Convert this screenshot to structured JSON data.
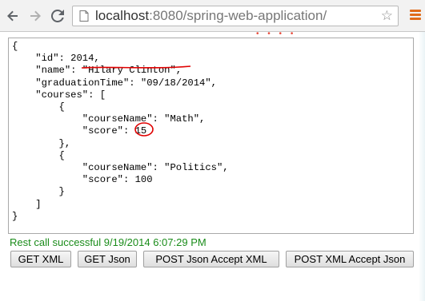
{
  "browser": {
    "url_host": "localhost",
    "url_rest": ":8080/spring-web-application/",
    "icons": {
      "back": "back-arrow-icon",
      "forward": "forward-arrow-icon",
      "reload": "reload-icon",
      "page": "page-icon",
      "bookmark": "star-icon",
      "menu": "hamburger-menu-icon"
    }
  },
  "json_response": {
    "lines": [
      "{",
      "    \"id\": 2014,",
      "    \"name\": \"Hilary Clinton\",",
      "    \"graduationTime\": \"09/18/2014\",",
      "    \"courses\": [",
      "        {",
      "            \"courseName\": \"Math\",",
      "            \"score\": 15",
      "        },",
      "        {",
      "            \"courseName\": \"Politics\",",
      "            \"score\": 100",
      "        }",
      "    ]",
      "}"
    ]
  },
  "status": {
    "message": "Rest call successful 9/19/2014 6:07:29 PM",
    "color": "#1a8c1a"
  },
  "buttons": {
    "get_xml": "GET XML",
    "get_json": "GET Json",
    "post_json_accept_xml": "POST Json Accept XML",
    "post_xml_accept_json": "POST XML Accept Json"
  },
  "annotation_color": "#e00000"
}
